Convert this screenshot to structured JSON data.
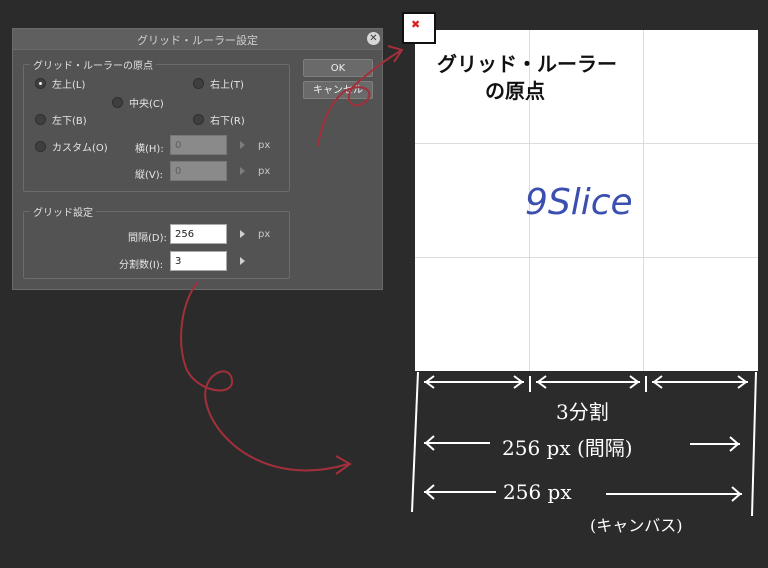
{
  "dialog": {
    "title": "グリッド・ルーラー設定",
    "origin_group": {
      "legend": "グリッド・ルーラーの原点",
      "radios": {
        "top_left": "左上(L)",
        "top_right": "右上(T)",
        "center": "中央(C)",
        "bottom_left": "左下(B)",
        "bottom_right": "右下(R)",
        "custom": "カスタム(O)"
      },
      "selected": "top_left",
      "horizontal_label": "横(H):",
      "horizontal_value": "0",
      "vertical_label": "縦(V):",
      "vertical_value": "0",
      "unit": "px"
    },
    "grid_group": {
      "legend": "グリッド設定",
      "interval_label": "間隔(D):",
      "interval_value": "256",
      "interval_unit": "px",
      "divisions_label": "分割数(I):",
      "divisions_value": "3"
    },
    "buttons": {
      "ok": "OK",
      "cancel": "キャンセル"
    }
  },
  "annotations": {
    "origin_note_line1": "グリッド・ルーラー",
    "origin_note_line2": "の原点",
    "canvas_text": "9Slice",
    "divisions_note": "3分割",
    "interval_note": "256 px (間隔)",
    "canvas_note": "256 px",
    "canvas_note_sub": "(キャンバス)"
  },
  "colors": {
    "background": "#2b2b2b",
    "dialog": "#535353",
    "annotation_red": "#a2303a",
    "annotation_blue": "#3a4fb0",
    "annotation_white": "#ffffff"
  }
}
